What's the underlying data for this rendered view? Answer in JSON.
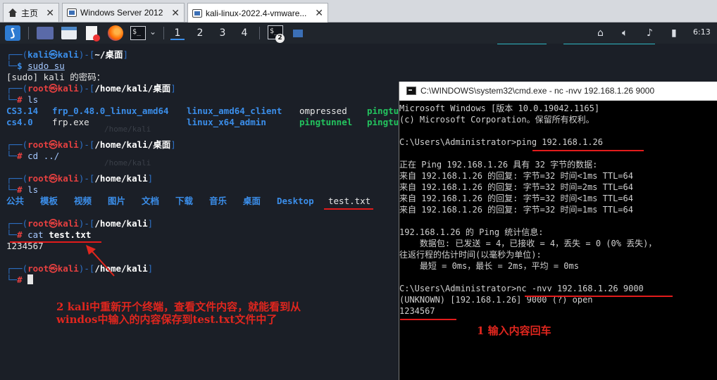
{
  "tabs": [
    {
      "label": "主页",
      "icon": "home-icon"
    },
    {
      "label": "Windows Server 2012",
      "icon": "vm-icon"
    },
    {
      "label": "kali-linux-2022.4-vmware...",
      "icon": "vm-icon",
      "active": true
    }
  ],
  "panel": {
    "workspaces": [
      "1",
      "2",
      "3",
      "4"
    ],
    "taskbar_badge": "2",
    "clock": "6:13"
  },
  "kali_terminal": {
    "l1_user": "kali㉿kali",
    "l1_path": "~/桌面",
    "l2_cmd": "sudo su",
    "l3": "[sudo] kali 的密码：",
    "l4_user": "root㉿kali",
    "l4_path": "/home/kali/桌面",
    "l5_cmd": "ls",
    "ls1": {
      "c1": "CS3.14",
      "c2": "frp_0.48.0_linux_amd64",
      "c3": "linux_amd64_client",
      "c4": "ompressed",
      "c5": "pingtu"
    },
    "ls2": {
      "c1": "cs4.0",
      "c2": "frp.exe",
      "c3": "linux_x64_admin",
      "c4": "pingtunnel",
      "c5": "pingtu"
    },
    "l8_user": "root㉿kali",
    "l8_path": "/home/kali/桌面",
    "l9_cmd": "cd ../",
    "l11_user": "root㉿kali",
    "l11_path": "/home/kali",
    "l12_cmd": "ls",
    "dirs": [
      "公共",
      "模板",
      "视频",
      "图片",
      "文档",
      "下载",
      "音乐",
      "桌面",
      "Desktop"
    ],
    "file": "test.txt",
    "l15_user": "root㉿kali",
    "l15_path": "/home/kali",
    "l16_cmd": "cat",
    "l16_arg": "test.txt",
    "l17": "1234567",
    "l19_user": "root㉿kali",
    "l19_path": "/home/kali",
    "ghost1": "/home/kali",
    "ghost2": "/home/kali"
  },
  "cmd": {
    "title": "C:\\WINDOWS\\system32\\cmd.exe - nc  -nvv 192.168.1.26 9000",
    "lines": [
      "Microsoft Windows [版本 10.0.19042.1165]",
      "(c) Microsoft Corporation。保留所有权利。",
      "",
      "C:\\Users\\Administrator>ping 192.168.1.26",
      "",
      "正在 Ping 192.168.1.26 具有 32 字节的数据:",
      "来自 192.168.1.26 的回复: 字节=32 时间<1ms TTL=64",
      "来自 192.168.1.26 的回复: 字节=32 时间=2ms TTL=64",
      "来自 192.168.1.26 的回复: 字节=32 时间<1ms TTL=64",
      "来自 192.168.1.26 的回复: 字节=32 时间=1ms TTL=64",
      "",
      "192.168.1.26 的 Ping 统计信息:",
      "    数据包: 已发送 = 4，已接收 = 4，丢失 = 0 (0% 丢失)，",
      "往返行程的估计时间(以毫秒为单位):",
      "    最短 = 0ms，最长 = 2ms，平均 = 0ms",
      "",
      "C:\\Users\\Administrator>nc -nvv 192.168.1.26 9000",
      "(UNKNOWN) [192.168.1.26] 9000 (?) open",
      "1234567"
    ]
  },
  "annotations": {
    "left_line1": "2 kali中重新开个终端，查看文件内容，就能看到从",
    "left_line2": "windos中输入的内容保存到test.txt文件中了",
    "right": "1 输入内容回车"
  },
  "colors": {
    "annotation_red": "#e0261e",
    "kali_blue": "#3b8eea",
    "root_red": "#e64040"
  }
}
